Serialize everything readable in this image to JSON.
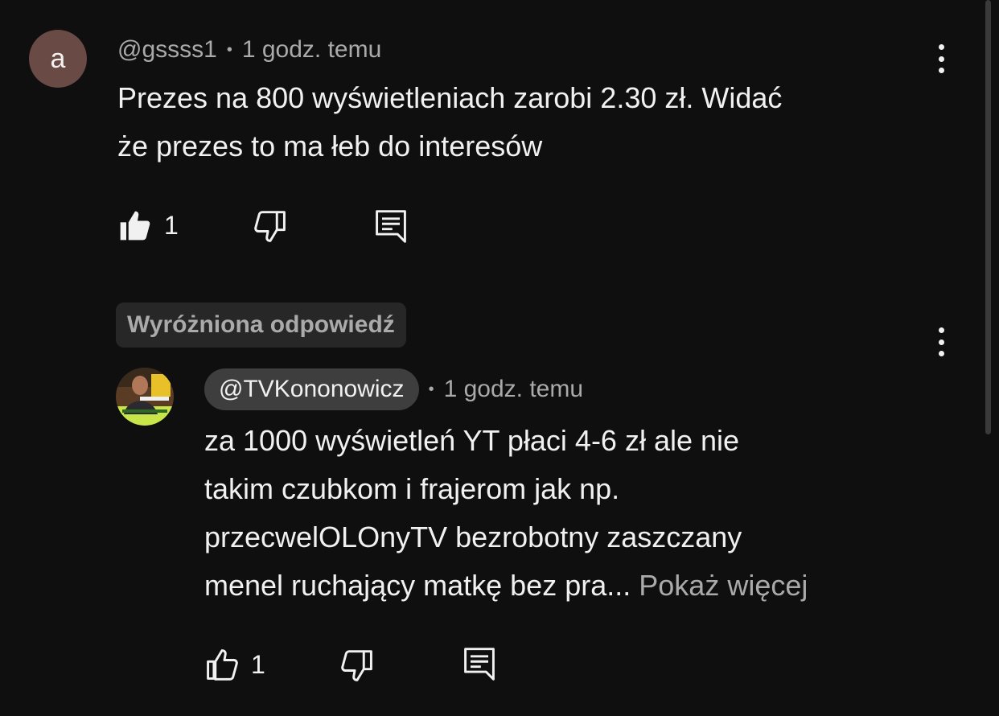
{
  "comment": {
    "avatar_letter": "a",
    "author": "@gssss1",
    "time": "1 godz. temu",
    "text_line1": "Prezes na 800 wyświetleniach zarobi 2.30 zł. Widać",
    "text_line2": "że prezes to ma łeb do interesów",
    "like_count": "1",
    "icons": {
      "like": "thumbs-up-filled-icon",
      "dislike": "thumbs-down-icon",
      "reply": "reply-icon",
      "more": "more-vert-icon"
    }
  },
  "reply": {
    "badge": "Wyróżniona odpowiedź",
    "author": "@TVKononowicz",
    "time": "1 godz. temu",
    "text_line1": "za 1000 wyświetleń YT płaci 4-6 zł ale nie",
    "text_line2": "takim czubkom i frajerom jak np.",
    "text_line3": "przecwelOLOnyTV bezrobotny zaszczany",
    "text_line4": "menel ruchający matkę bez pra...",
    "show_more": "Pokaż więcej",
    "like_count": "1",
    "icons": {
      "like": "thumbs-up-outline-icon",
      "dislike": "thumbs-down-icon",
      "reply": "reply-icon",
      "more": "more-vert-icon"
    }
  },
  "colors": {
    "background": "#0f0f0f",
    "text_primary": "#f1f1f1",
    "text_secondary": "#aaaaaa",
    "avatar_a": "#6a4a44",
    "pill": "#3e3e3e",
    "badge": "#272727"
  }
}
